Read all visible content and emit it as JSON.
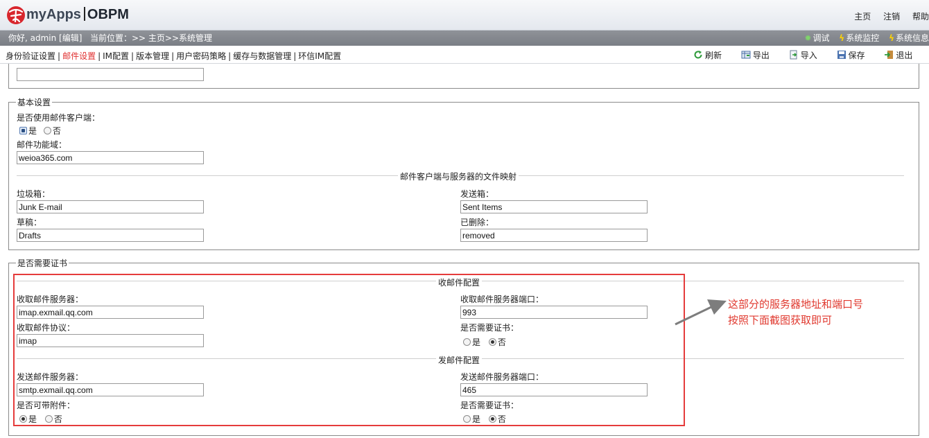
{
  "header": {
    "brand_left": "myApps",
    "brand_right": "OBPM",
    "links": [
      "主页",
      "注销",
      "帮助"
    ]
  },
  "userbar": {
    "greeting": "你好, admin [编辑]",
    "location": "当前位置：>> 主页>>系统管理",
    "tools": [
      {
        "label": "调试",
        "icon": "gear-icon"
      },
      {
        "label": "系统监控",
        "icon": "lightning-icon"
      },
      {
        "label": "系统信息",
        "icon": "lightning-icon"
      }
    ]
  },
  "nav": {
    "tabs": [
      "身份验证设置",
      "邮件设置",
      "IM配置",
      "版本管理",
      "用户密码策略",
      "缓存与数据管理",
      "环信IM配置"
    ],
    "active_tab": "邮件设置",
    "actions": [
      {
        "label": "刷新",
        "icon": "refresh-icon"
      },
      {
        "label": "导出",
        "icon": "export-icon"
      },
      {
        "label": "导入",
        "icon": "import-icon"
      },
      {
        "label": "保存",
        "icon": "save-icon"
      },
      {
        "label": "退出",
        "icon": "exit-icon"
      }
    ]
  },
  "basic": {
    "legend": "基本设置",
    "use_client_label": "是否使用邮件客户端：",
    "yes": "是",
    "no": "否",
    "domain_label": "邮件功能域：",
    "domain_value": "weioa365.com",
    "mapping_title": "邮件客户端与服务器的文件映射",
    "junk_label": "垃圾箱：",
    "junk_value": "Junk E-mail",
    "sent_label": "发送箱：",
    "sent_value": "Sent Items",
    "drafts_label": "草稿：",
    "drafts_value": "Drafts",
    "deleted_label": "已删除：",
    "deleted_value": "removed"
  },
  "cert": {
    "legend": "是否需要证书",
    "receive_title": "收邮件配置",
    "recv_server_label": "收取邮件服务器：",
    "recv_server_value": "imap.exmail.qq.com",
    "recv_port_label": "收取邮件服务器端口：",
    "recv_port_value": "993",
    "recv_protocol_label": "收取邮件协议：",
    "recv_protocol_value": "imap",
    "recv_cert_label": "是否需要证书：",
    "send_title": "发邮件配置",
    "send_server_label": "发送邮件服务器：",
    "send_server_value": "smtp.exmail.qq.com",
    "send_port_label": "发送邮件服务器端口：",
    "send_port_value": "465",
    "attach_label": "是否可带附件：",
    "send_cert_label": "是否需要证书：",
    "yes": "是",
    "no": "否"
  },
  "annotation": {
    "line1": "这部分的服务器地址和端口号",
    "line2": "按照下面截图获取即可",
    "color": "#e0392f"
  }
}
